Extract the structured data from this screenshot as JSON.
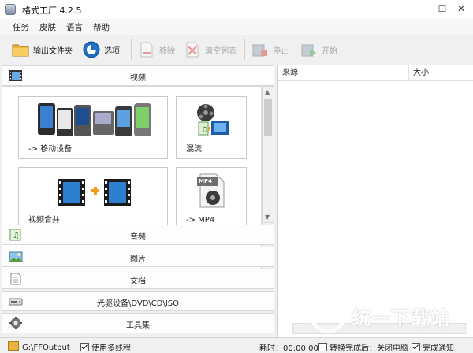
{
  "window": {
    "title": "格式工厂 4.2.5",
    "minimize": "—",
    "maximize": "☐",
    "close": "✕"
  },
  "menu": [
    "任务",
    "皮肤",
    "语言",
    "帮助"
  ],
  "toolbar": {
    "output_folder": "输出文件夹",
    "options": "选项",
    "remove": "移除",
    "clear_list": "清空列表",
    "stop": "停止",
    "start": "开始"
  },
  "categories": {
    "video": "视频",
    "audio": "音频",
    "picture": "图片",
    "document": "文档",
    "disc": "光驱设备\\DVD\\CD\\ISO",
    "tools": "工具集"
  },
  "video_items": [
    {
      "label": "-> 移动设备",
      "icon": "mobile-devices-icon"
    },
    {
      "label": "混流",
      "icon": "mux-icon"
    },
    {
      "label": "视频合并",
      "icon": "video-join-icon"
    },
    {
      "label": "-> MP4",
      "icon": "mp4-file-icon",
      "badge": "MP4"
    }
  ],
  "task_list": {
    "col_source": "来源",
    "col_size": "大小"
  },
  "status": {
    "output_path": "G:\\FFOutput",
    "multithread": "使用多线程",
    "elapsed": "耗时：00:00:00",
    "after_convert": "转换完成后：关闭电脑",
    "notify": "完成通知"
  },
  "watermark": "统一下载站",
  "colors": {
    "accent_orange": "#f39a1e",
    "film_blue": "#2f7fd0"
  }
}
